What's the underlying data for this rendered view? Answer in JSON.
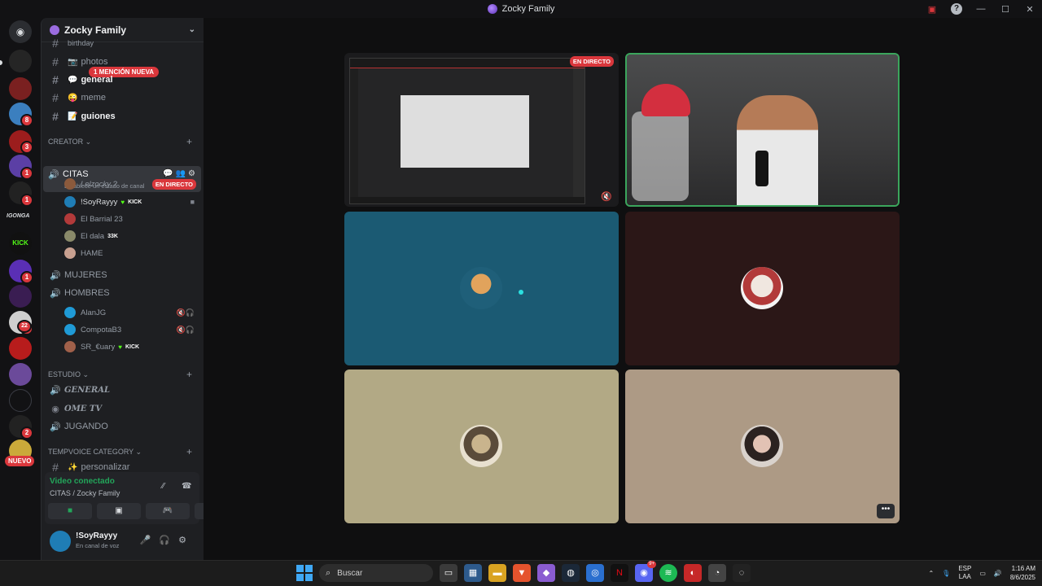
{
  "window": {
    "title": "Zocky Family"
  },
  "guild_badges": [
    "8",
    "3",
    "1",
    "1",
    "1",
    "1",
    "22",
    "2"
  ],
  "guild_text": {
    "iconga": "IGONGA",
    "kick": "KICK",
    "nuevo": "NUEVO"
  },
  "server": {
    "name": "Zocky Family"
  },
  "mention_pill": "1 MENCIÓN NUEVA",
  "text_channels": [
    {
      "name": "photos",
      "emoji": "📷"
    },
    {
      "name": "general",
      "emoji": "💬"
    },
    {
      "name": "meme",
      "emoji": "😜"
    },
    {
      "name": "guiones",
      "emoji": "📝"
    }
  ],
  "top_partial": "birthday",
  "categories": {
    "creator": "CREATOR",
    "estudio": "ESTUDIO",
    "tempvoice": "TEMPVOICE CATEGORY"
  },
  "active_voice": {
    "name": "CITAS",
    "status": "Establece un estado de canal"
  },
  "citas_users": [
    {
      "name": "! elzocky ?",
      "live": "EN DIRECTO"
    },
    {
      "name": "!SoyRayyy",
      "tag": "KICK"
    },
    {
      "name": "El Barrial 23"
    },
    {
      "name": "El dala",
      "tag": "33K"
    },
    {
      "name": "HAME"
    }
  ],
  "voice_channels": {
    "mujeres": "MUJERES",
    "hombres": "HOMBRES",
    "general": "GENERAL",
    "ome": "OME TV",
    "jugando": "JUGANDO"
  },
  "hombres_users": [
    {
      "name": "AlanJG"
    },
    {
      "name": "CompotaB3"
    },
    {
      "name": "SR_€uary",
      "tag": "KICK"
    }
  ],
  "temp_channel": {
    "name": "personalizar",
    "emoji": "✨"
  },
  "voice_panel": {
    "status": "Video conectado",
    "channel": "CITAS / Zocky Family"
  },
  "me": {
    "name": "!SoyRayyy",
    "status": "En canal de voz"
  },
  "stage": {
    "live_badge": "EN DIRECTO"
  },
  "taskbar": {
    "search": "Buscar",
    "lang_1": "ESP",
    "lang_2": "LAA",
    "time": "1:16 AM",
    "date": "8/6/2025",
    "discord_badge": "9+"
  },
  "colors": {
    "accent_green": "#23a55a",
    "live_red": "#da373c",
    "blurple": "#5865f2"
  }
}
